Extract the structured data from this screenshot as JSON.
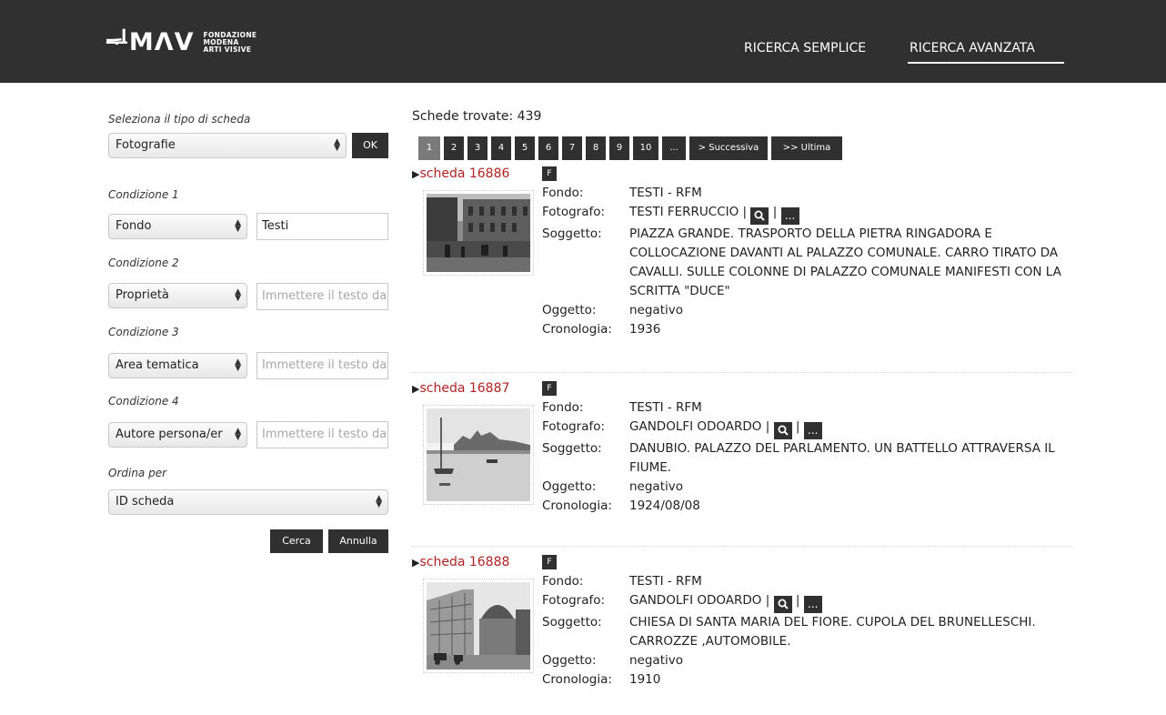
{
  "header": {
    "logo_mark": "ᆗMΛV",
    "logo_sub": [
      "FONDAZIONE",
      "MODENA",
      "ARTI VISIVE"
    ],
    "nav": [
      {
        "label": "RICERCA SEMPLICE"
      },
      {
        "label": "RICERCA AVANZATA"
      }
    ]
  },
  "sidebar": {
    "type_label": "Seleziona il tipo di scheda",
    "type_value": "Fotografie",
    "ok_label": "OK",
    "conditions": [
      {
        "label": "Condizione 1",
        "field": "Fondo",
        "value": "Testi",
        "placeholder": ""
      },
      {
        "label": "Condizione 2",
        "field": "Proprietà",
        "value": "",
        "placeholder": "Immettere il testo da"
      },
      {
        "label": "Condizione 3",
        "field": "Area tematica",
        "value": "",
        "placeholder": "Immettere il testo da"
      },
      {
        "label": "Condizione 4",
        "field": "Autore persona/er",
        "value": "",
        "placeholder": "Immettere il testo da"
      }
    ],
    "order_label": "Ordina per",
    "order_value": "ID scheda",
    "search_label": "Cerca",
    "cancel_label": "Annulla"
  },
  "results": {
    "count_text": "Schede trovate: 439",
    "pages": [
      "1",
      "2",
      "3",
      "4",
      "5",
      "6",
      "7",
      "8",
      "9",
      "10",
      "...",
      "> Successiva",
      ">> Ultima"
    ],
    "active_page": "1",
    "field_labels": {
      "fondo": "Fondo:",
      "fotografo": "Fotografo:",
      "soggetto": "Soggetto:",
      "oggetto": "Oggetto:",
      "cronologia": "Cronologia:"
    },
    "badge": "F",
    "more_label": "...",
    "records": [
      {
        "title": "scheda 16886",
        "fondo": "TESTI - RFM",
        "fotografo": "TESTI FERRUCCIO |",
        "soggetto": "PIAZZA GRANDE. TRASPORTO DELLA PIETRA RINGADORA E COLLOCAZIONE DAVANTI AL PALAZZO COMUNALE. CARRO TIRATO DA CAVALLI. SULLE COLONNE DI PALAZZO COMUNALE MANIFESTI CON LA SCRITTA \"DUCE\"",
        "oggetto": "negativo",
        "cronologia": "1936"
      },
      {
        "title": "scheda 16887",
        "fondo": "TESTI - RFM",
        "fotografo": "GANDOLFI ODOARDO |",
        "soggetto": "DANUBIO. PALAZZO DEL PARLAMENTO. UN BATTELLO ATTRAVERSA IL FIUME.",
        "oggetto": "negativo",
        "cronologia": "1924/08/08"
      },
      {
        "title": "scheda 16888",
        "fondo": "TESTI - RFM",
        "fotografo": "GANDOLFI ODOARDO |",
        "soggetto": "CHIESA DI SANTA MARIA DEL FIORE. CUPOLA DEL BRUNELLESCHI. CARROZZE ,AUTOMOBILE.",
        "oggetto": "negativo",
        "cronologia": "1910"
      }
    ]
  }
}
